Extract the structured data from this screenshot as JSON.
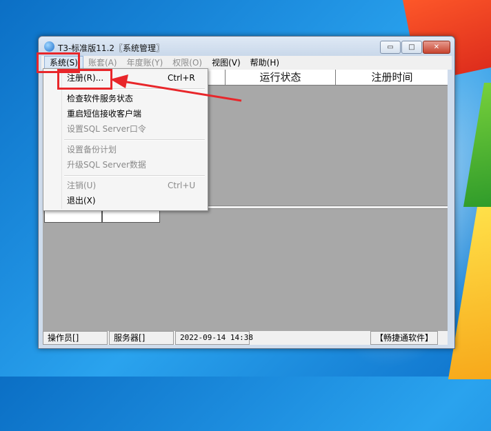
{
  "window": {
    "title": "T3-标准版11.2〖系统管理〗",
    "controls": {
      "minimize": "▭",
      "maximize": "□",
      "close": "✕"
    }
  },
  "menubar": {
    "items": [
      {
        "label": "系统(S)",
        "state": "active"
      },
      {
        "label": "账套(A)",
        "state": "disabled"
      },
      {
        "label": "年度账(Y)",
        "state": "disabled"
      },
      {
        "label": "权限(O)",
        "state": "disabled"
      },
      {
        "label": "视图(V)",
        "state": "enabled"
      },
      {
        "label": "帮助(H)",
        "state": "enabled"
      }
    ]
  },
  "dropdown": {
    "items": [
      {
        "label": "注册(R)...",
        "shortcut": "Ctrl+R",
        "disabled": false
      },
      {
        "label": "检查软件服务状态",
        "shortcut": "",
        "disabled": false
      },
      {
        "label": "重启短信接收客户端",
        "shortcut": "",
        "disabled": false
      },
      {
        "label": "设置SQL Server口令",
        "shortcut": "",
        "disabled": true
      },
      {
        "label": "设置备份计划",
        "shortcut": "",
        "disabled": true
      },
      {
        "label": "升级SQL Server数据",
        "shortcut": "",
        "disabled": true
      },
      {
        "label": "注销(U)",
        "shortcut": "Ctrl+U",
        "disabled": true
      },
      {
        "label": "退出(X)",
        "shortcut": "",
        "disabled": false
      }
    ]
  },
  "grid": {
    "columns": [
      "运行状态",
      "注册时间"
    ]
  },
  "statusbar": {
    "operator": "操作员[]",
    "server": "服务器[]",
    "datetime": "2022-09-14 14:38",
    "brand": "【畅捷通软件】"
  },
  "colors": {
    "highlight": "#e8262a",
    "client_bg": "#a8a8a8"
  }
}
